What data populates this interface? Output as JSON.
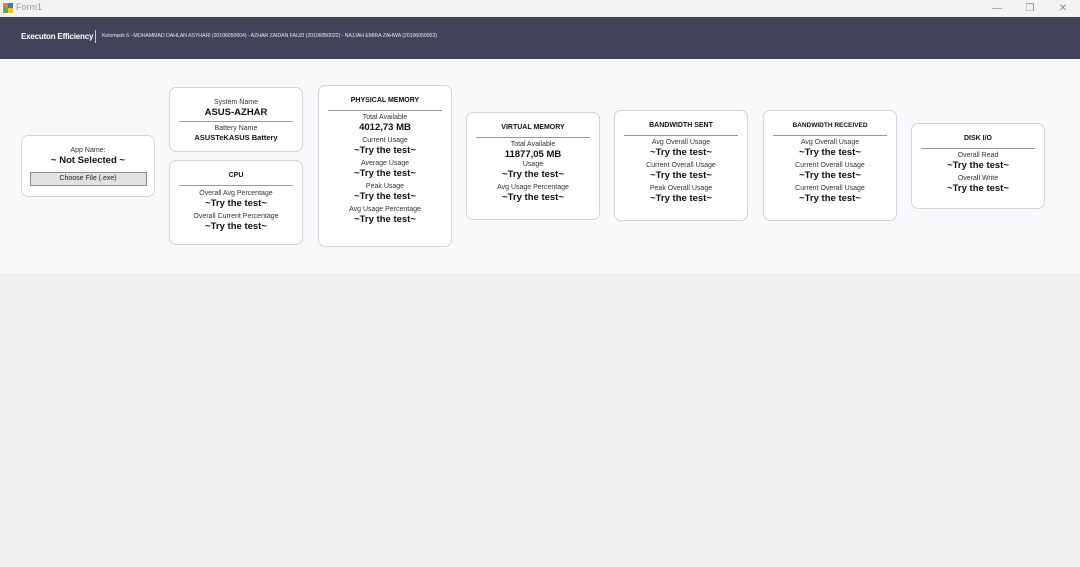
{
  "window": {
    "title": "Form1",
    "controls": {
      "minimize": "—",
      "maximize": "❐",
      "close": "✕"
    }
  },
  "header": {
    "brand": "Executon Efficiency",
    "members": "Kelompok 6  -  MOHAMMAD DAHLAN ASYHARI (20106050004)  -  AZHAR ZAIDAN FAUZI (20106050022)  -  NAJJAH EMIRA ZAHWA (20106050053)"
  },
  "app_card": {
    "label": "App Name:",
    "value": "~ Not Selected ~",
    "button_label": "Choose File (.exe)"
  },
  "system_card": {
    "system_label": "System Name",
    "system_value": "ASUS-AZHAR",
    "battery_label": "Battery Name",
    "battery_value": "ASUSTeKASUS Battery"
  },
  "cpu_card": {
    "title": "CPU",
    "items": [
      {
        "label": "Overall Avg Percentage",
        "value": "~Try the test~"
      },
      {
        "label": "Overall Current Percentage",
        "value": "~Try the test~"
      }
    ]
  },
  "physical_memory_card": {
    "title": "PHYSICAL MEMORY",
    "items": [
      {
        "label": "Total Available",
        "value": "4012,73 MB"
      },
      {
        "label": "Current Usage",
        "value": "~Try the test~"
      },
      {
        "label": "Average Usage",
        "value": "~Try the test~"
      },
      {
        "label": "Peak Usage",
        "value": "~Try the test~"
      },
      {
        "label": "Avg Usage Percentage",
        "value": "~Try the test~"
      }
    ]
  },
  "virtual_memory_card": {
    "title": "VIRTUAL MEMORY",
    "items": [
      {
        "label": "Total Available",
        "value": "11877,05 MB"
      },
      {
        "label": "Usage",
        "value": "~Try the test~"
      },
      {
        "label": "Avg Usage Percentage",
        "value": "~Try the test~"
      }
    ]
  },
  "bandwidth_sent_card": {
    "title": "BANDWIDTH SENT",
    "items": [
      {
        "label": "Avg Overall Usage",
        "value": "~Try the test~"
      },
      {
        "label": "Current Overall Usage",
        "value": "~Try the test~"
      },
      {
        "label": "Peak Overall Usage",
        "value": "~Try the test~"
      }
    ]
  },
  "bandwidth_received_card": {
    "title": "BANDWIDTH RECEIVED",
    "items": [
      {
        "label": "Avg Overall Usage",
        "value": "~Try the test~"
      },
      {
        "label": "Current Overall Usage",
        "value": "~Try the test~"
      },
      {
        "label": "Current Overall Usage",
        "value": "~Try the test~"
      }
    ]
  },
  "disk_card": {
    "title": "DISK I/O",
    "items": [
      {
        "label": "Overall Read",
        "value": "~Try the test~"
      },
      {
        "label": "Overall Write",
        "value": "~Try the test~"
      }
    ]
  }
}
